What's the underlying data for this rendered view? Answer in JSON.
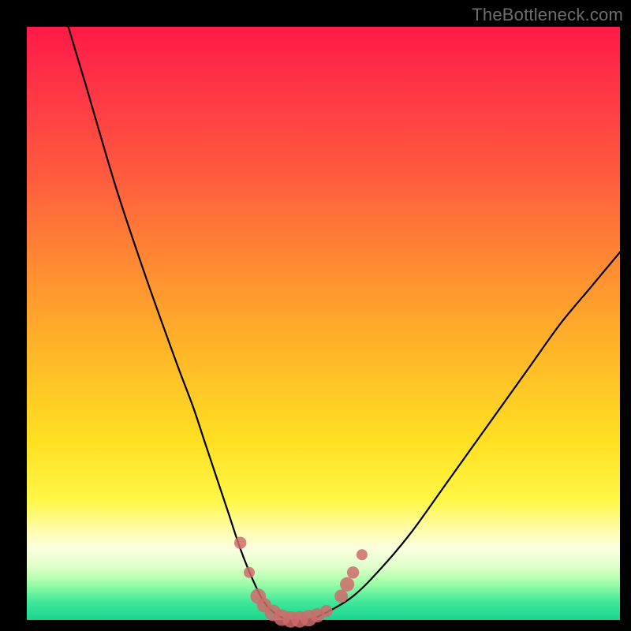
{
  "watermark": "TheBottleneck.com",
  "chart_data": {
    "type": "line",
    "title": "",
    "xlabel": "",
    "ylabel": "",
    "xlim": [
      0,
      100
    ],
    "ylim": [
      0,
      100
    ],
    "series": [
      {
        "name": "bottleneck-curve",
        "x": [
          7,
          10,
          15,
          20,
          25,
          28,
          30,
          32,
          34,
          36,
          38,
          40,
          42,
          44,
          45,
          47,
          50,
          55,
          60,
          65,
          70,
          75,
          80,
          85,
          90,
          95,
          100
        ],
        "y": [
          100,
          90,
          73,
          58,
          44,
          36,
          30,
          24,
          18,
          12,
          7,
          3,
          1,
          0,
          0,
          0,
          1,
          4,
          9,
          15,
          22,
          29,
          36,
          43,
          50,
          56,
          62
        ]
      }
    ],
    "markers": {
      "name": "sample-points",
      "color": "#cf6b6b",
      "points": [
        {
          "x": 36.0,
          "y": 13.0,
          "r": 1.1
        },
        {
          "x": 37.5,
          "y": 8.0,
          "r": 1.0
        },
        {
          "x": 39.0,
          "y": 4.0,
          "r": 1.4
        },
        {
          "x": 40.0,
          "y": 2.5,
          "r": 1.3
        },
        {
          "x": 41.5,
          "y": 1.2,
          "r": 1.5
        },
        {
          "x": 43.0,
          "y": 0.4,
          "r": 1.5
        },
        {
          "x": 44.5,
          "y": 0.1,
          "r": 1.5
        },
        {
          "x": 46.0,
          "y": 0.1,
          "r": 1.5
        },
        {
          "x": 47.5,
          "y": 0.3,
          "r": 1.5
        },
        {
          "x": 49.0,
          "y": 0.8,
          "r": 1.3
        },
        {
          "x": 50.5,
          "y": 1.5,
          "r": 1.1
        },
        {
          "x": 53.0,
          "y": 4.0,
          "r": 1.2
        },
        {
          "x": 54.0,
          "y": 6.0,
          "r": 1.3
        },
        {
          "x": 55.0,
          "y": 8.0,
          "r": 1.1
        },
        {
          "x": 56.5,
          "y": 11.0,
          "r": 1.0
        }
      ]
    },
    "gradient_stops": [
      {
        "pos": 0,
        "color": "#ff1a47"
      },
      {
        "pos": 25,
        "color": "#ff5b3e"
      },
      {
        "pos": 55,
        "color": "#ffb728"
      },
      {
        "pos": 80,
        "color": "#fff748"
      },
      {
        "pos": 90,
        "color": "#dfffca"
      },
      {
        "pos": 100,
        "color": "#1ad58f"
      }
    ]
  }
}
